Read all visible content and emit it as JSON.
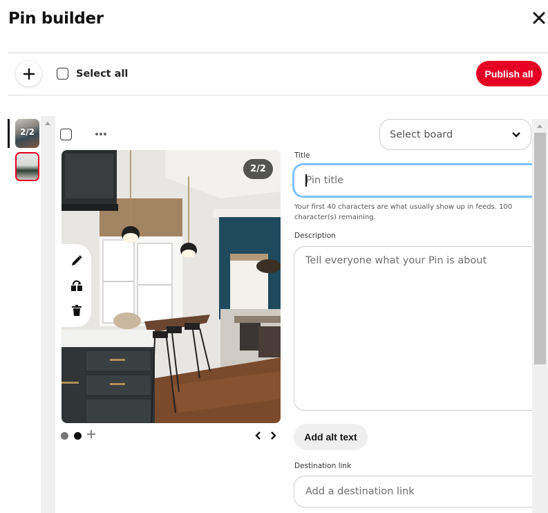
{
  "header": {
    "title": "Pin builder",
    "close_icon": "close-icon"
  },
  "toolbar": {
    "add_icon": "plus-icon",
    "select_all_label": "Select all",
    "select_all_checked": false,
    "publish_label": "Publish all",
    "publish_color": "#e60023"
  },
  "thumbnails": [
    {
      "label": "2/2",
      "selected": true
    },
    {
      "label": "",
      "selected": false,
      "error": true
    }
  ],
  "pin": {
    "checked": false,
    "more_icon": "ellipsis-icon",
    "image_counter": "2/2",
    "image_description": "Kitchen with dark cabinets, brass pendant lights, window bar with stools, and dining area with teal wall",
    "tools": [
      "pencil-icon",
      "replace-icon",
      "trash-icon"
    ],
    "carousel": {
      "slides": 2,
      "active_index": 1,
      "add_icon": "plus-icon",
      "prev_icon": "chevron-left-icon",
      "next_icon": "chevron-right-icon"
    }
  },
  "form": {
    "board_select": {
      "placeholder": "Select board",
      "icon": "chevron-down-icon"
    },
    "title": {
      "label": "Title",
      "placeholder": "Pin title",
      "value": "",
      "hint": "Your first 40 characters are what usually show up in feeds. 100 character(s) remaining."
    },
    "description": {
      "label": "Description",
      "placeholder": "Tell everyone what your Pin is about",
      "value": ""
    },
    "alt_text_button": "Add alt text",
    "destination": {
      "label": "Destination link",
      "placeholder": "Add a destination link",
      "value": ""
    }
  },
  "colors": {
    "accent": "#e60023",
    "focus_ring": "#7fc1ff"
  }
}
